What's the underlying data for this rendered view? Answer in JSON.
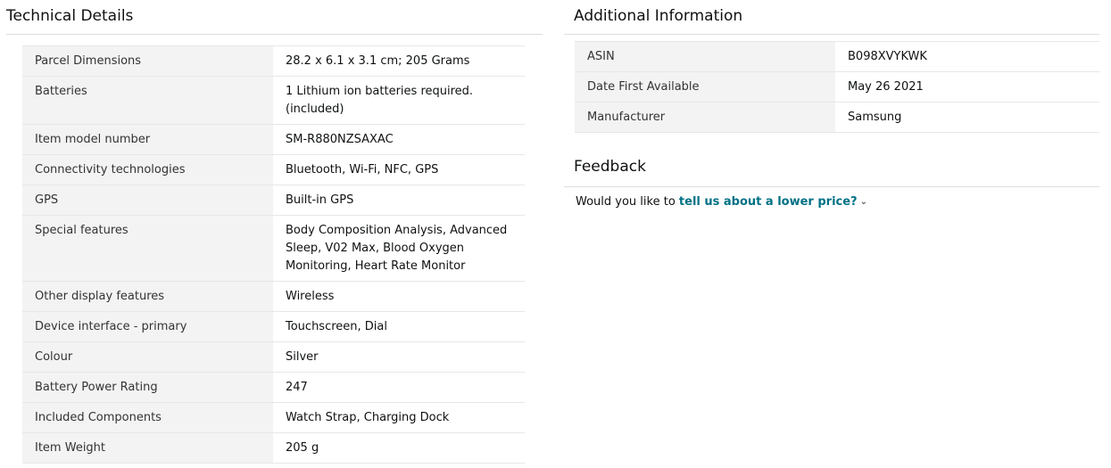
{
  "technical_details": {
    "title": "Technical Details",
    "rows": [
      {
        "key": "Parcel Dimensions",
        "value": "28.2 x 6.1 x 3.1 cm; 205 Grams"
      },
      {
        "key": "Batteries",
        "value": "1 Lithium ion batteries required. (included)"
      },
      {
        "key": "Item model number",
        "value": "SM-R880NZSAXAC"
      },
      {
        "key": "Connectivity technologies",
        "value": "Bluetooth, Wi-Fi, NFC, GPS"
      },
      {
        "key": "GPS",
        "value": "Built-in GPS"
      },
      {
        "key": "Special features",
        "value": "Body Composition Analysis, Advanced Sleep, V02 Max, Blood Oxygen Monitoring, Heart Rate Monitor"
      },
      {
        "key": "Other display features",
        "value": "Wireless"
      },
      {
        "key": "Device interface - primary",
        "value": "Touchscreen, Dial"
      },
      {
        "key": "Colour",
        "value": "Silver"
      },
      {
        "key": "Battery Power Rating",
        "value": "247"
      },
      {
        "key": "Included Components",
        "value": "Watch Strap, Charging Dock"
      },
      {
        "key": "Item Weight",
        "value": "205 g"
      }
    ]
  },
  "additional_information": {
    "title": "Additional Information",
    "rows": [
      {
        "key": "ASIN",
        "value": "B098XVYKWK"
      },
      {
        "key": "Date First Available",
        "value": "May 26 2021"
      },
      {
        "key": "Manufacturer",
        "value": "Samsung"
      }
    ]
  },
  "feedback": {
    "title": "Feedback",
    "prompt": "Would you like to",
    "link_text": "tell us about a lower price?",
    "link_icon": "chevron-down-icon"
  }
}
